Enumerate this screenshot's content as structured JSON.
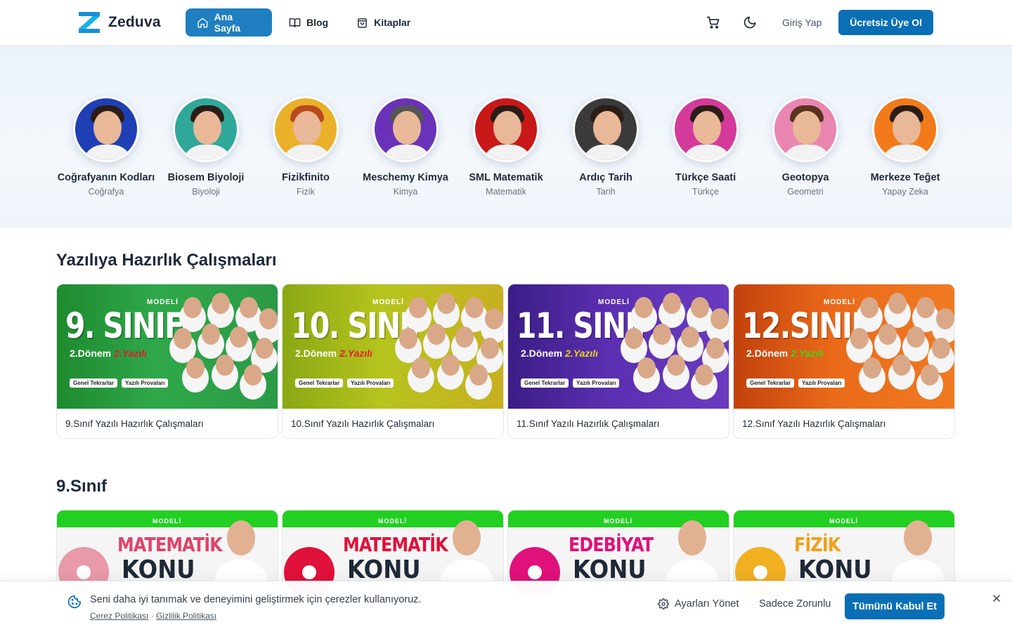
{
  "brand": {
    "name": "Zeduva",
    "accent": "#1f7fc1",
    "primary_button": "#0a6fb5"
  },
  "nav": {
    "links": [
      {
        "label": "Ana Sayfa",
        "icon": "home-icon",
        "active": true
      },
      {
        "label": "Blog",
        "icon": "book-icon",
        "active": false
      },
      {
        "label": "Kitaplar",
        "icon": "shopping-bag-icon",
        "active": false
      }
    ],
    "cart_icon": "cart-icon",
    "theme_icon": "moon-icon",
    "login_label": "Giriş Yap",
    "signup_label": "Ücretsiz Üye Ol"
  },
  "teachers": [
    {
      "name": "Coğrafyanın Kodları",
      "subject": "Coğrafya",
      "bg": "#1f3fb5"
    },
    {
      "name": "Biosem Biyoloji",
      "subject": "Biyoloji",
      "bg": "#2fa89a"
    },
    {
      "name": "Fizikfinito",
      "subject": "Fizik",
      "bg": "#eab02a"
    },
    {
      "name": "Meschemy Kimya",
      "subject": "Kimya",
      "bg": "#6a32b8"
    },
    {
      "name": "SML Matematik",
      "subject": "Matematik",
      "bg": "#c81818"
    },
    {
      "name": "Ardıç Tarih",
      "subject": "Tarih",
      "bg": "#3a3a3a"
    },
    {
      "name": "Türkçe Saati",
      "subject": "Türkçe",
      "bg": "#d43a9a"
    },
    {
      "name": "Geotopya",
      "subject": "Geometri",
      "bg": "#e986b0"
    },
    {
      "name": "Merkeze Teğet",
      "subject": "Yapay Zeka",
      "bg": "#f27a1a"
    }
  ],
  "section1": {
    "title": "Yazılıya Hazırlık Çalışmaları",
    "cards": [
      {
        "title": "9.Sınıf Yazılı Hazırlık Çalışmaları",
        "grade": "9. SINIF",
        "term": "2.Dönem",
        "term_highlight": "2.Yazılı",
        "highlight_color": "#e11d2a",
        "bg": "linear-gradient(90deg,#1e8a2e 0%,#2fa84a 45%,#2b9a46 100%)"
      },
      {
        "title": "10.Sınıf Yazılı Hazırlık Çalışmaları",
        "grade": "10. SINIF",
        "term": "2.Dönem",
        "term_highlight": "2.Yazılı",
        "highlight_color": "#e11d2a",
        "bg": "linear-gradient(90deg,#8aa814 0%,#b6c41e 45%,#c8b020 100%)"
      },
      {
        "title": "11.Sınıf Yazılı Hazırlık Çalışmaları",
        "grade": "11. SINIF",
        "term": "2.Dönem",
        "term_highlight": "2.Yazılı",
        "highlight_color": "#e6d21a",
        "bg": "linear-gradient(90deg,#3b1d86 0%,#5a2fb0 45%,#6a3ac0 100%)"
      },
      {
        "title": "12.Sınıf Yazılı Hazırlık Çalışmaları",
        "grade": "12.SINIF",
        "term": "2.Dönem",
        "term_highlight": "2.Yazılı",
        "highlight_color": "#46d11e",
        "bg": "linear-gradient(90deg,#c2410c 0%,#ea6a1a 45%,#f07a22 100%)"
      }
    ],
    "pills": [
      "Genel Tekrarlar",
      "Yazılı Provaları"
    ],
    "badge": "MODELİ"
  },
  "section2": {
    "title": "9.Sınıf",
    "badge": "MODELİ",
    "cards": [
      {
        "subject": "MATEMATİK",
        "konu": "KONU",
        "color": "#e0436a",
        "circle": "#e99aa8"
      },
      {
        "subject": "MATEMATİK",
        "konu": "KONU",
        "color": "#e0113a",
        "circle": "#e0113a"
      },
      {
        "subject": "EDEBİYAT",
        "konu": "KONU",
        "color": "#e0117a",
        "circle": "#e0117a"
      },
      {
        "subject": "FİZİK",
        "konu": "KONU",
        "color": "#f0a01a",
        "circle": "#f0b020"
      }
    ]
  },
  "cookie": {
    "message": "Seni daha iyi tanımak ve deneyimini geliştirmek için çerezler kullanıyoruz.",
    "policy_link": "Çerez Politikası",
    "separator": "·",
    "privacy_link": "Gizlilik Politikası",
    "settings_label": "Ayarları Yönet",
    "necessary_label": "Sadece Zorunlu",
    "accept_label": "Tümünü Kabul Et"
  }
}
